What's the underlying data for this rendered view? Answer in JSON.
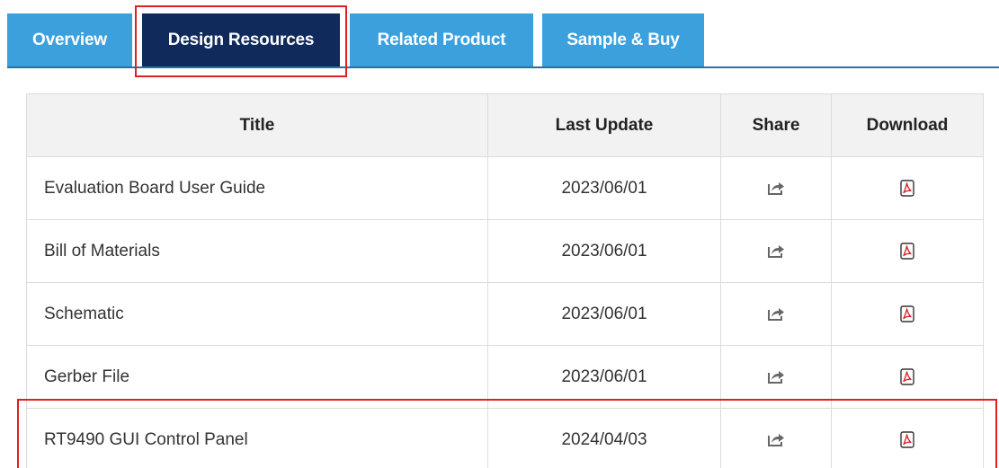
{
  "tabs": [
    {
      "label": "Overview",
      "active": false
    },
    {
      "label": "Design Resources",
      "active": true
    },
    {
      "label": "Related Product",
      "active": false
    },
    {
      "label": "Sample & Buy",
      "active": false
    }
  ],
  "table": {
    "headers": {
      "title": "Title",
      "last_update": "Last Update",
      "share": "Share",
      "download": "Download"
    },
    "rows": [
      {
        "title": "Evaluation Board User Guide",
        "last_update": "2023/06/01",
        "share_icon": "share-icon",
        "download_icon": "pdf-icon"
      },
      {
        "title": "Bill of Materials",
        "last_update": "2023/06/01",
        "share_icon": "share-icon",
        "download_icon": "pdf-icon"
      },
      {
        "title": "Schematic",
        "last_update": "2023/06/01",
        "share_icon": "share-icon",
        "download_icon": "pdf-icon"
      },
      {
        "title": "Gerber File",
        "last_update": "2023/06/01",
        "share_icon": "share-icon",
        "download_icon": "pdf-icon"
      },
      {
        "title": "RT9490 GUI Control Panel",
        "last_update": "2024/04/03",
        "share_icon": "share-icon",
        "download_icon": "pdf-icon"
      }
    ]
  },
  "colors": {
    "tab_inactive": "#3ba0dc",
    "tab_active": "#102a5c",
    "highlight": "#e02020",
    "pdf_red": "#d9262e",
    "share_gray": "#666666"
  }
}
